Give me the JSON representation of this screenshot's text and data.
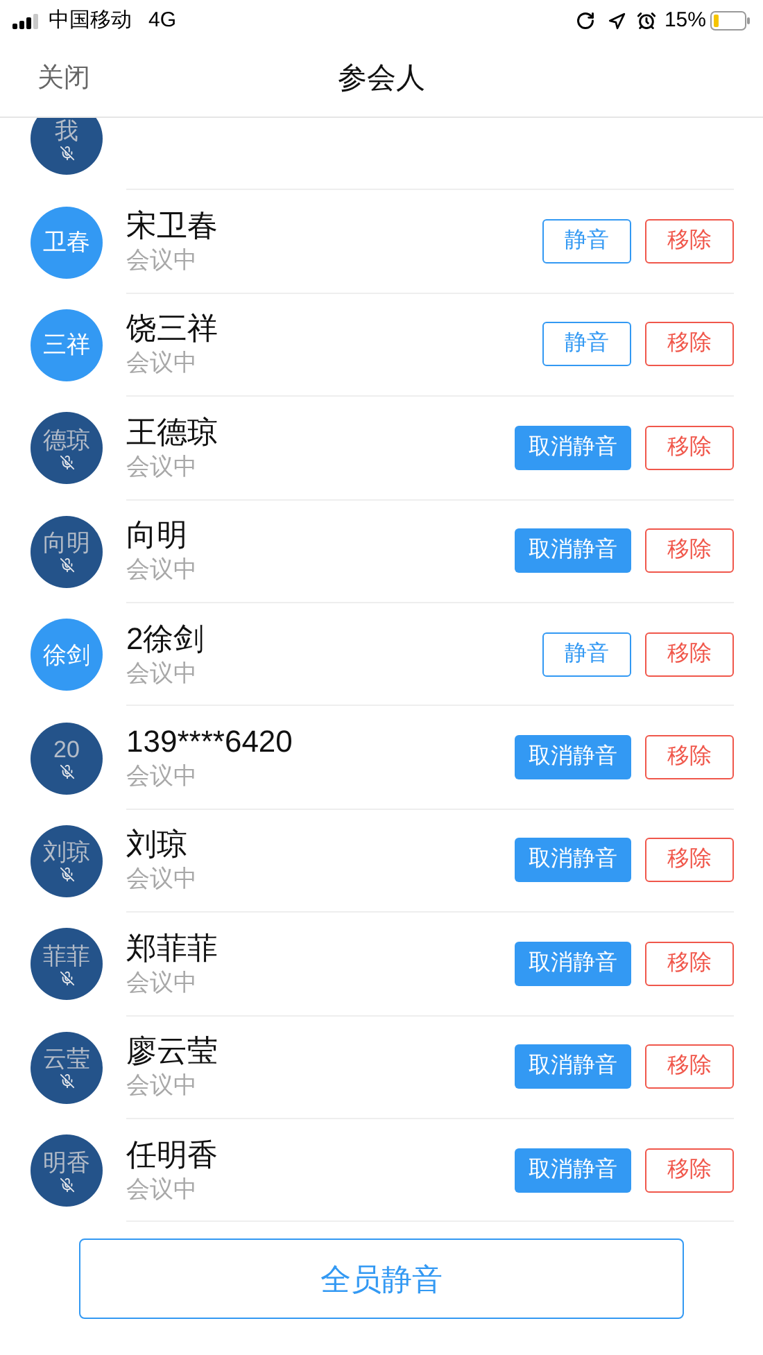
{
  "status_bar": {
    "carrier": "中国移动",
    "network": "4G",
    "battery": "15%"
  },
  "nav": {
    "close": "关闭",
    "title": "参会人"
  },
  "participants": [
    {
      "avatar": "我",
      "muted": true
    },
    {
      "avatar": "卫春",
      "name": "宋卫春",
      "status": "会议中",
      "muted": false,
      "mute_button": "静音",
      "remove_button": "移除"
    },
    {
      "avatar": "三祥",
      "name": "饶三祥",
      "status": "会议中",
      "muted": false,
      "mute_button": "静音",
      "remove_button": "移除"
    },
    {
      "avatar": "德琼",
      "name": "王德琼",
      "status": "会议中",
      "muted": true,
      "mute_button": "取消静音",
      "remove_button": "移除"
    },
    {
      "avatar": "向明",
      "name": "向明",
      "status": "会议中",
      "muted": true,
      "mute_button": "取消静音",
      "remove_button": "移除"
    },
    {
      "avatar": "徐剑",
      "name": "2徐剑",
      "status": "会议中",
      "muted": false,
      "mute_button": "静音",
      "remove_button": "移除"
    },
    {
      "avatar": "20",
      "name": "139****6420",
      "status": "会议中",
      "muted": true,
      "mute_button": "取消静音",
      "remove_button": "移除"
    },
    {
      "avatar": "刘琼",
      "name": "刘琼",
      "status": "会议中",
      "muted": true,
      "mute_button": "取消静音",
      "remove_button": "移除"
    },
    {
      "avatar": "菲菲",
      "name": "郑菲菲",
      "status": "会议中",
      "muted": true,
      "mute_button": "取消静音",
      "remove_button": "移除"
    },
    {
      "avatar": "云莹",
      "name": "廖云莹",
      "status": "会议中",
      "muted": true,
      "mute_button": "取消静音",
      "remove_button": "移除"
    },
    {
      "avatar": "明香",
      "name": "任明香",
      "status": "会议中",
      "muted": true,
      "mute_button": "取消静音",
      "remove_button": "移除"
    }
  ],
  "footer_button": "全员静音"
}
